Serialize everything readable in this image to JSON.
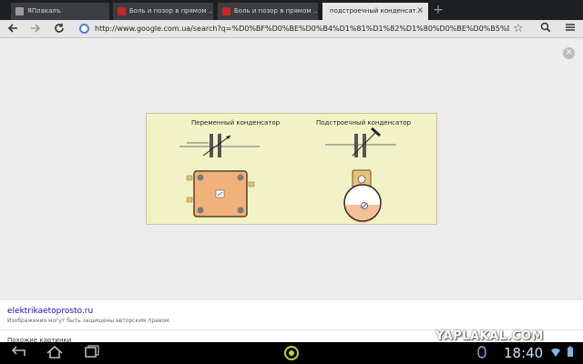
{
  "tabs": [
    {
      "title": "ЯПлакалъ",
      "active": false,
      "favicon_color": "#9a9a9a"
    },
    {
      "title": "Боль и позор в прямом ...",
      "active": false,
      "favicon_color": "#c62828"
    },
    {
      "title": "Боль и позор в прямом ...",
      "active": false,
      "favicon_color": "#c62828"
    },
    {
      "title": "подстроечный конденсат...",
      "active": true,
      "favicon_color": "#ffffff"
    }
  ],
  "toolbar": {
    "back_icon": "arrow-left-icon",
    "forward_icon": "arrow-right-icon",
    "reload_icon": "reload-icon",
    "url": "http://www.google.com.ua/search?q=%D0%BF%D0%BE%D0%B4%D1%81%D1%82%D1%80%D0%BE%D0%B5%D1%87%D0%BD%D1%8B",
    "bookmark_icon": "star-icon",
    "search_icon": "search-icon",
    "menu_icon": "menu-icon"
  },
  "viewer": {
    "close_icon": "close-icon",
    "figure": {
      "left_caption": "Переменный конденсатор",
      "right_caption": "Подстроечный конденсатор"
    }
  },
  "info": {
    "site": "elektrikaetoprosto.ru",
    "copyright": "Изображения могут быть защищены авторским правом.",
    "similar": "Похожие картинки",
    "watermark": "YAPLAKAL.COM"
  },
  "system_bar": {
    "back_icon": "back-icon",
    "home_icon": "home-icon",
    "recent_icon": "recent-apps-icon",
    "clock": "18:40",
    "accent": "#b5d43a"
  }
}
